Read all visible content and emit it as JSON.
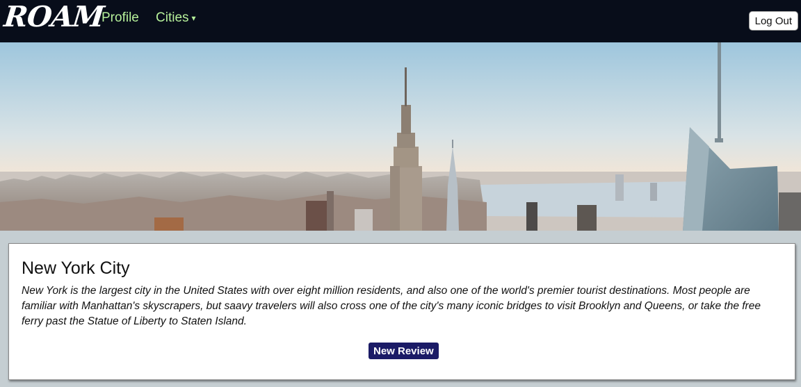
{
  "nav": {
    "logo": "ROAM",
    "profile_label": "Profile",
    "cities_label": "Cities",
    "cities_caret": "▾",
    "logout_label": "Log Out"
  },
  "city": {
    "name": "New York City",
    "description": "New York is the largest city in the United States with over eight million residents, and also one of the world's premier tourist destinations. Most people are familiar with Manhattan's skyscrapers, but saavy travelers will also cross one of the city's many iconic bridges to visit Brooklyn and Queens, or take the free ferry past the Statue of Liberty to Staten Island.",
    "new_review_label": "New Review"
  },
  "colors": {
    "navbar_bg": "#080d1a",
    "nav_link": "#b6f09a",
    "review_button": "#1b1b66",
    "page_bg": "#c5ced2"
  }
}
